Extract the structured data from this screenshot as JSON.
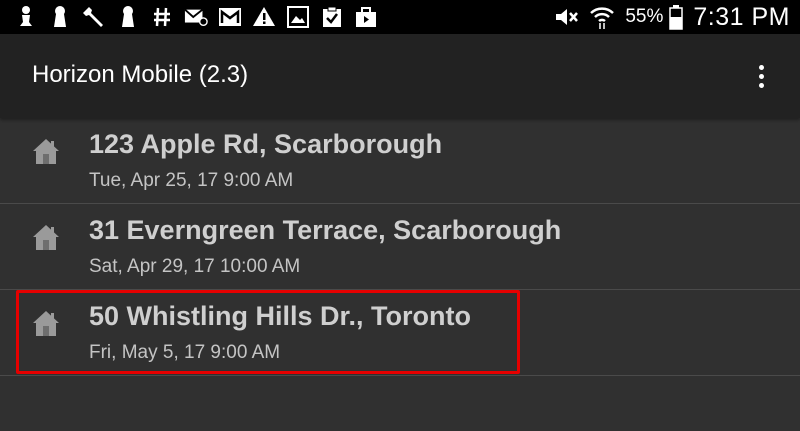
{
  "status_bar": {
    "left_icons": [
      "chess-pawn-icon",
      "keyhole-icon",
      "wrench-icon",
      "keyhole-icon",
      "hash-icon",
      "voicemail-icon",
      "gmail-icon",
      "warning-icon",
      "gallery-icon",
      "clipboard-check-icon",
      "briefcase-icon"
    ],
    "right_icons": [
      "mute-icon",
      "wifi-icon",
      "battery-icon"
    ],
    "battery": "55%",
    "time": "7:31 PM"
  },
  "app_bar": {
    "title": "Horizon Mobile (2.3)",
    "overflow_icon": "more-vert-icon"
  },
  "appointments": [
    {
      "address": "123 Apple Rd, Scarborough",
      "datetime": "Tue, Apr 25, 17 9:00 AM"
    },
    {
      "address": "31 Everngreen Terrace, Scarborough",
      "datetime": "Sat, Apr 29, 17 10:00 AM"
    },
    {
      "address": "50 Whistling Hills Dr., Toronto",
      "datetime": "Fri, May 5, 17 9:00 AM"
    }
  ],
  "colors": {
    "status_bar_bg": "#000000",
    "app_bar_bg": "#222222",
    "content_bg": "#303030",
    "highlight": "#e60000"
  }
}
